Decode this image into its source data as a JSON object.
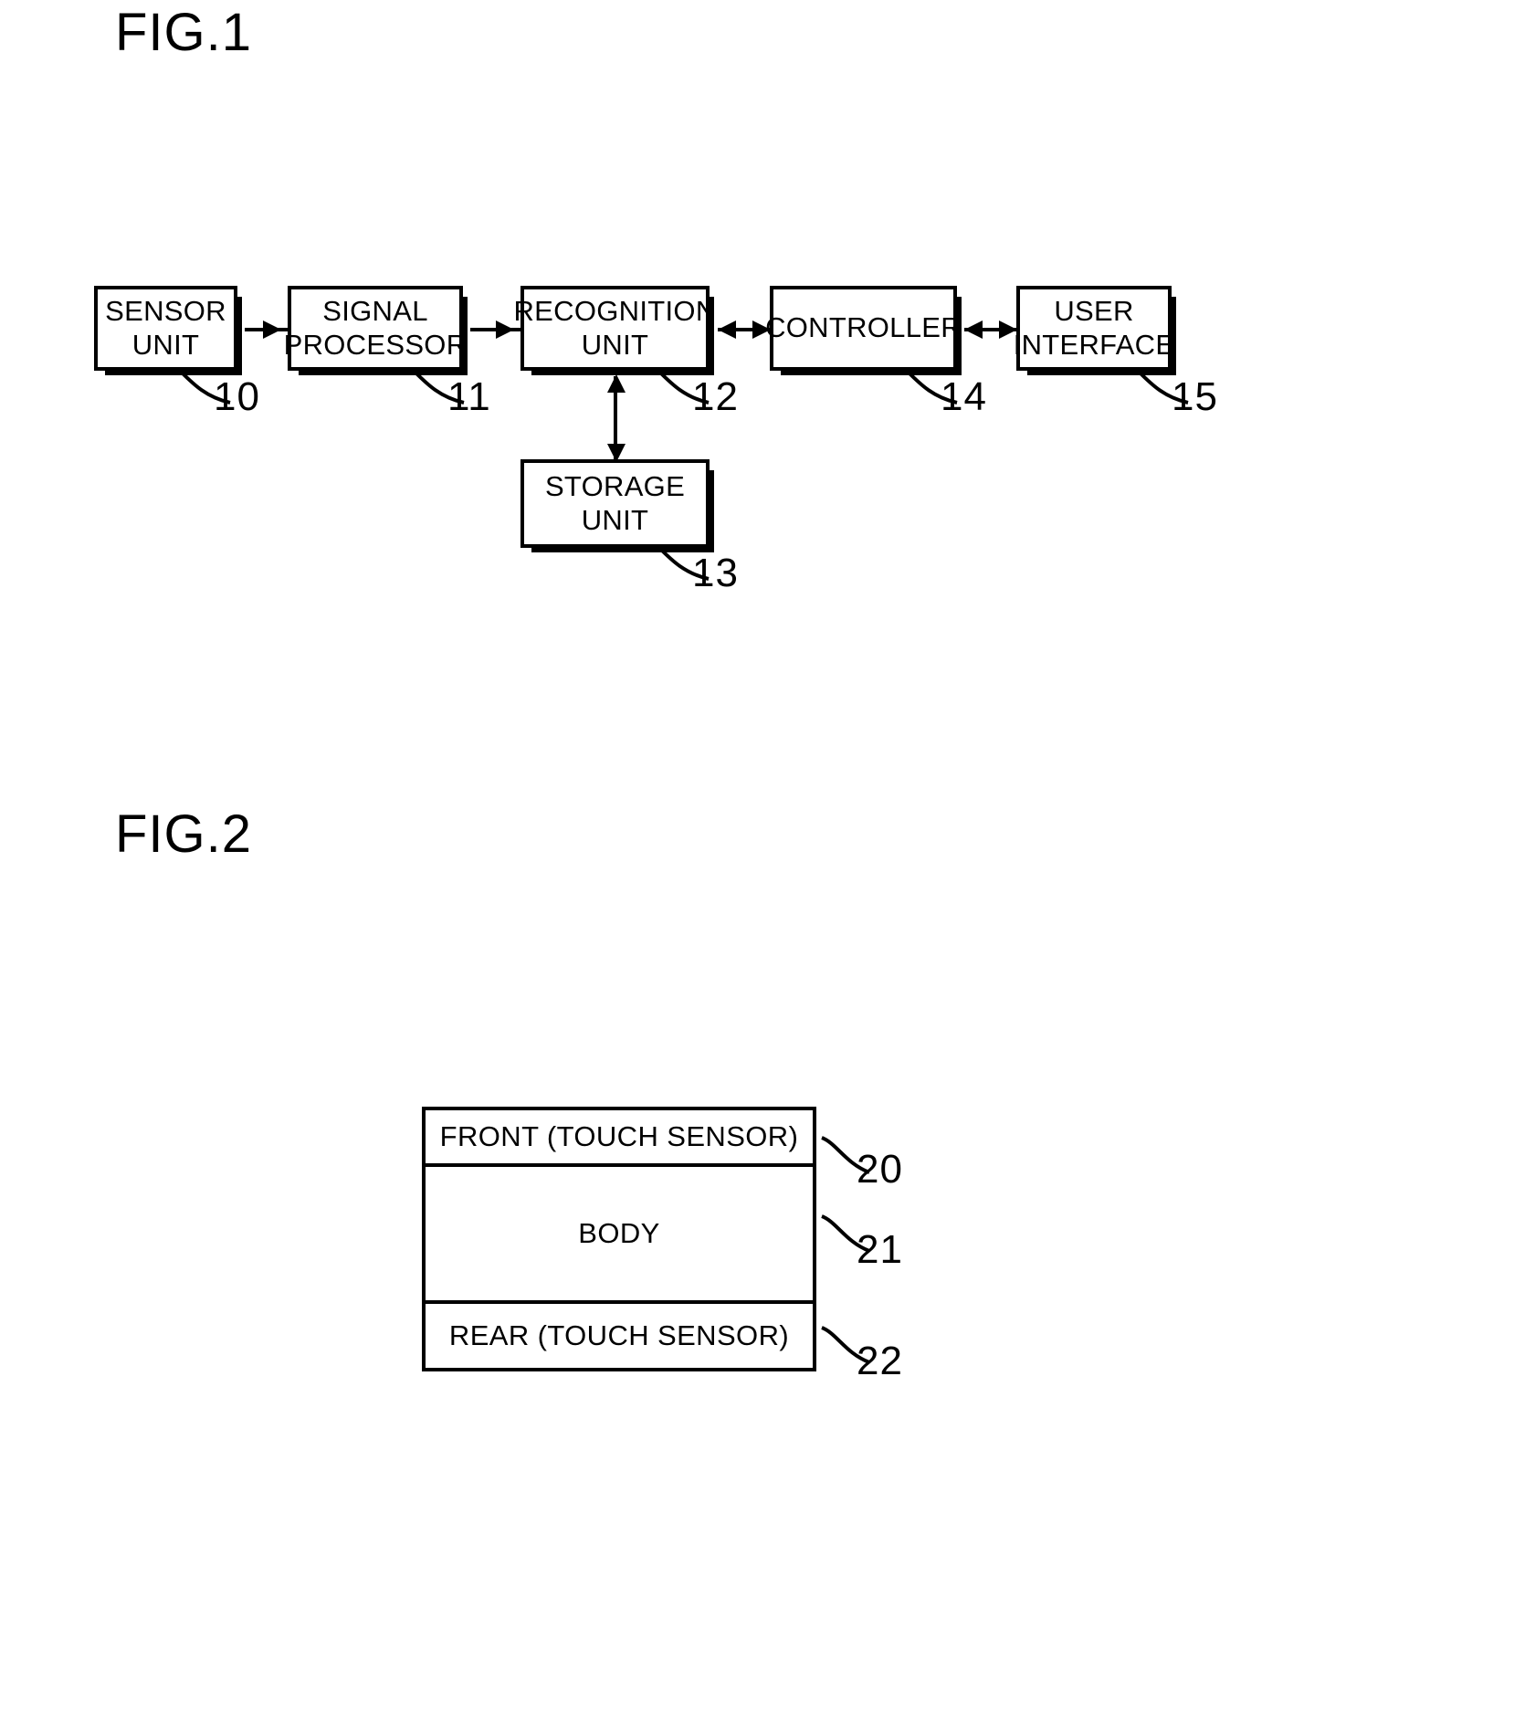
{
  "figures": [
    {
      "id": "fig1",
      "title": "FIG.1",
      "blocks": [
        {
          "key": "sensor_unit",
          "label": "SENSOR\nUNIT",
          "ref": "10"
        },
        {
          "key": "signal_processor",
          "label": "SIGNAL\nPROCESSOR",
          "ref": "11"
        },
        {
          "key": "recognition_unit",
          "label": "RECOGNITION\nUNIT",
          "ref": "12"
        },
        {
          "key": "storage_unit",
          "label": "STORAGE\nUNIT",
          "ref": "13"
        },
        {
          "key": "controller",
          "label": "CONTROLLER",
          "ref": "14"
        },
        {
          "key": "user_interface",
          "label": "USER\nINTERFACE",
          "ref": "15"
        }
      ],
      "connections": [
        {
          "from": "sensor_unit",
          "to": "signal_processor",
          "direction": "one-way"
        },
        {
          "from": "signal_processor",
          "to": "recognition_unit",
          "direction": "one-way"
        },
        {
          "from": "recognition_unit",
          "to": "controller",
          "direction": "two-way"
        },
        {
          "from": "controller",
          "to": "user_interface",
          "direction": "two-way"
        },
        {
          "from": "recognition_unit",
          "to": "storage_unit",
          "direction": "two-way"
        }
      ]
    },
    {
      "id": "fig2",
      "title": "FIG.2",
      "layers": [
        {
          "key": "front",
          "label": "FRONT (TOUCH SENSOR)",
          "ref": "20"
        },
        {
          "key": "body",
          "label": "BODY",
          "ref": "21"
        },
        {
          "key": "rear",
          "label": "REAR (TOUCH SENSOR)",
          "ref": "22"
        }
      ]
    }
  ],
  "colors": {
    "ink": "#000000",
    "paper": "#ffffff"
  }
}
